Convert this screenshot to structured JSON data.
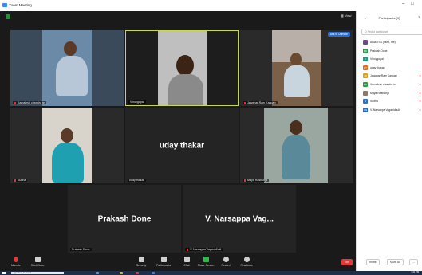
{
  "window": {
    "title": "Zoom Meeting"
  },
  "meeting": {
    "view_label": "View",
    "unmute_label": "Ask to Unmute"
  },
  "tiles": [
    {
      "name": "Kamalesh chandra te",
      "muted": true
    },
    {
      "name": "Vinoygopal",
      "muted": false
    },
    {
      "name": "Jawahar Ram Kanoan",
      "muted": true
    },
    {
      "name": "Sudha",
      "muted": true
    },
    {
      "name": "uday thakar",
      "big": "uday thakar",
      "muted": false
    },
    {
      "name": "Maya Rastoorja",
      "muted": true
    },
    {
      "name": "Prakash Done",
      "big": "Prakash Done",
      "muted": false
    },
    {
      "name": "V. Narsappa Vaganidhuli",
      "big": "V. Narsappa Vag...",
      "muted": true
    }
  ],
  "toolbar": {
    "items": [
      "Unmute",
      "Start Video",
      "Security",
      "Participants",
      "Chat",
      "Share Screen",
      "Record",
      "Reactions"
    ],
    "participant_count": "9",
    "end_label": "End"
  },
  "panel": {
    "title": "Participants (9)",
    "search_placeholder": "Q  Find a participant",
    "participants": [
      {
        "name": "Anila TSS (Host, me)",
        "initial": "",
        "color": "#6b4a8a",
        "status": ""
      },
      {
        "name": "Prakash Done",
        "initial": "PD",
        "color": "#2e9b4a",
        "status": ""
      },
      {
        "name": "Vinoygopal",
        "initial": "V",
        "color": "#1e9b8a",
        "status": ""
      },
      {
        "name": "uday thakar",
        "initial": "UT",
        "color": "#e06b1e",
        "status": ""
      },
      {
        "name": "Jawahar Ram Kanoan",
        "initial": "JR",
        "color": "#d9a11e",
        "status": "✕"
      },
      {
        "name": "Kamalesh chandra te",
        "initial": "KC",
        "color": "#2e9b4a",
        "status": "✕"
      },
      {
        "name": "Maya Rastoorja",
        "initial": "",
        "color": "#8a7a6a",
        "status": "✕"
      },
      {
        "name": "Sudha",
        "initial": "S",
        "color": "#2d6ccf",
        "status": "✕"
      },
      {
        "name": "V. Narsappa Vaganidhuli",
        "initial": "VN",
        "color": "#2d6ccf",
        "status": "✕"
      }
    ],
    "footer": {
      "invite": "Invite",
      "mute_all": "Mute All",
      "more": "..."
    }
  },
  "taskbar": {
    "search_placeholder": "Type here to search",
    "clock": "3:21 PM"
  }
}
